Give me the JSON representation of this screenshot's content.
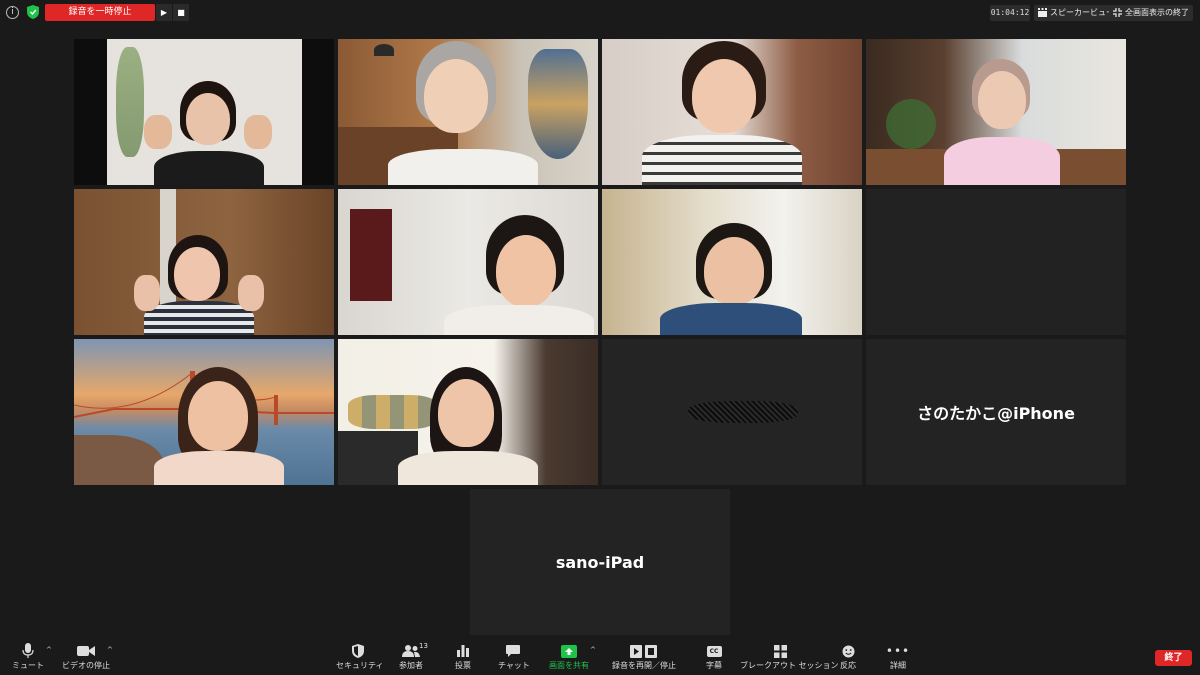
{
  "window": {
    "recording_label": "録音を一時停止",
    "pause_icon": "pause-icon",
    "stop_icon": "stop-icon",
    "elapsed_time": "01:04:12",
    "speaker_view_label": "スピーカービュー",
    "exit_fullscreen_label": "全画面表示の終了"
  },
  "tiles": {
    "name_tile_iphone": "さのたかこ@iPhone",
    "name_tile_ipad": "sano-iPad",
    "active_speaker_color": "#c9e23b"
  },
  "toolbar": {
    "mute_label": "ミュート",
    "video_label": "ビデオの停止",
    "security_label": "セキュリティ",
    "participants_label": "参加者",
    "participants_count": "13",
    "polls_label": "投票",
    "chat_label": "チャット",
    "share_label": "画面を共有",
    "record_label": "録音を再開／停止",
    "cc_label": "字幕",
    "cc_icon_text": "CC",
    "breakout_label": "ブレークアウト セッション",
    "reactions_label": "反応",
    "more_label": "詳細",
    "end_label": "終了",
    "share_color": "#1ec34a",
    "end_color": "#e02727"
  }
}
